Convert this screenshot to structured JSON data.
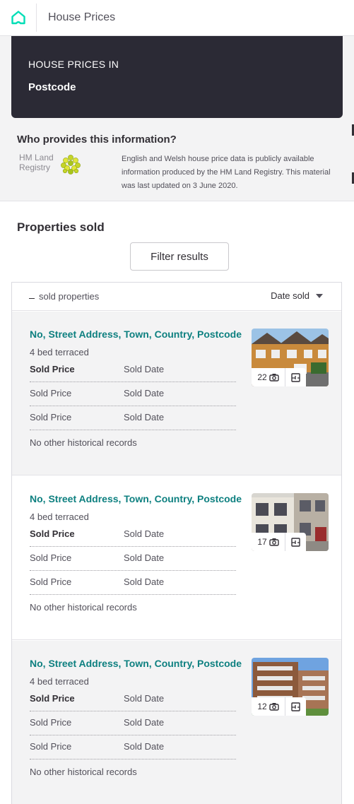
{
  "header": {
    "title": "House Prices"
  },
  "hero": {
    "subtitle": "HOUSE PRICES IN",
    "location": "Postcode"
  },
  "provider": {
    "title": "Who provides this information?",
    "logo_text": "HM Land Registry",
    "description": "English and Welsh house price data is publicly available information produced by the HM Land Registry.   This material was last updated on 3 June 2020."
  },
  "properties": {
    "title": "Properties sold",
    "filter_label": "Filter results",
    "count_label": "sold properties",
    "sort_label": "Date sold",
    "listings": [
      {
        "address": "No, Street Address, Town, Country, Postcode",
        "type": "4 bed terraced",
        "history": [
          {
            "price": "Sold Price",
            "date": "Sold Date"
          },
          {
            "price": "Sold Price",
            "date": "Sold Date"
          },
          {
            "price": "Sold Price",
            "date": "Sold Date"
          }
        ],
        "no_more": "No other historical records",
        "photo_count": "22"
      },
      {
        "address": "No, Street Address, Town, Country, Postcode",
        "type": "4 bed terraced",
        "history": [
          {
            "price": "Sold Price",
            "date": "Sold Date"
          },
          {
            "price": "Sold Price",
            "date": "Sold Date"
          },
          {
            "price": "Sold Price",
            "date": "Sold Date"
          }
        ],
        "no_more": "No other historical records",
        "photo_count": "17"
      },
      {
        "address": "No, Street Address, Town, Country, Postcode",
        "type": "4 bed terraced",
        "history": [
          {
            "price": "Sold Price",
            "date": "Sold Date"
          },
          {
            "price": "Sold Price",
            "date": "Sold Date"
          },
          {
            "price": "Sold Price",
            "date": "Sold Date"
          }
        ],
        "no_more": "No other historical records",
        "photo_count": "12"
      }
    ]
  },
  "colors": {
    "brand": "#0e8080",
    "hero": "#2b2a35",
    "panel": "#f3f3f4",
    "text": "#322f35"
  },
  "icons": [
    "home-icon",
    "camera-icon",
    "floorplan-icon",
    "chevron-down-icon",
    "land-registry-logo"
  ]
}
